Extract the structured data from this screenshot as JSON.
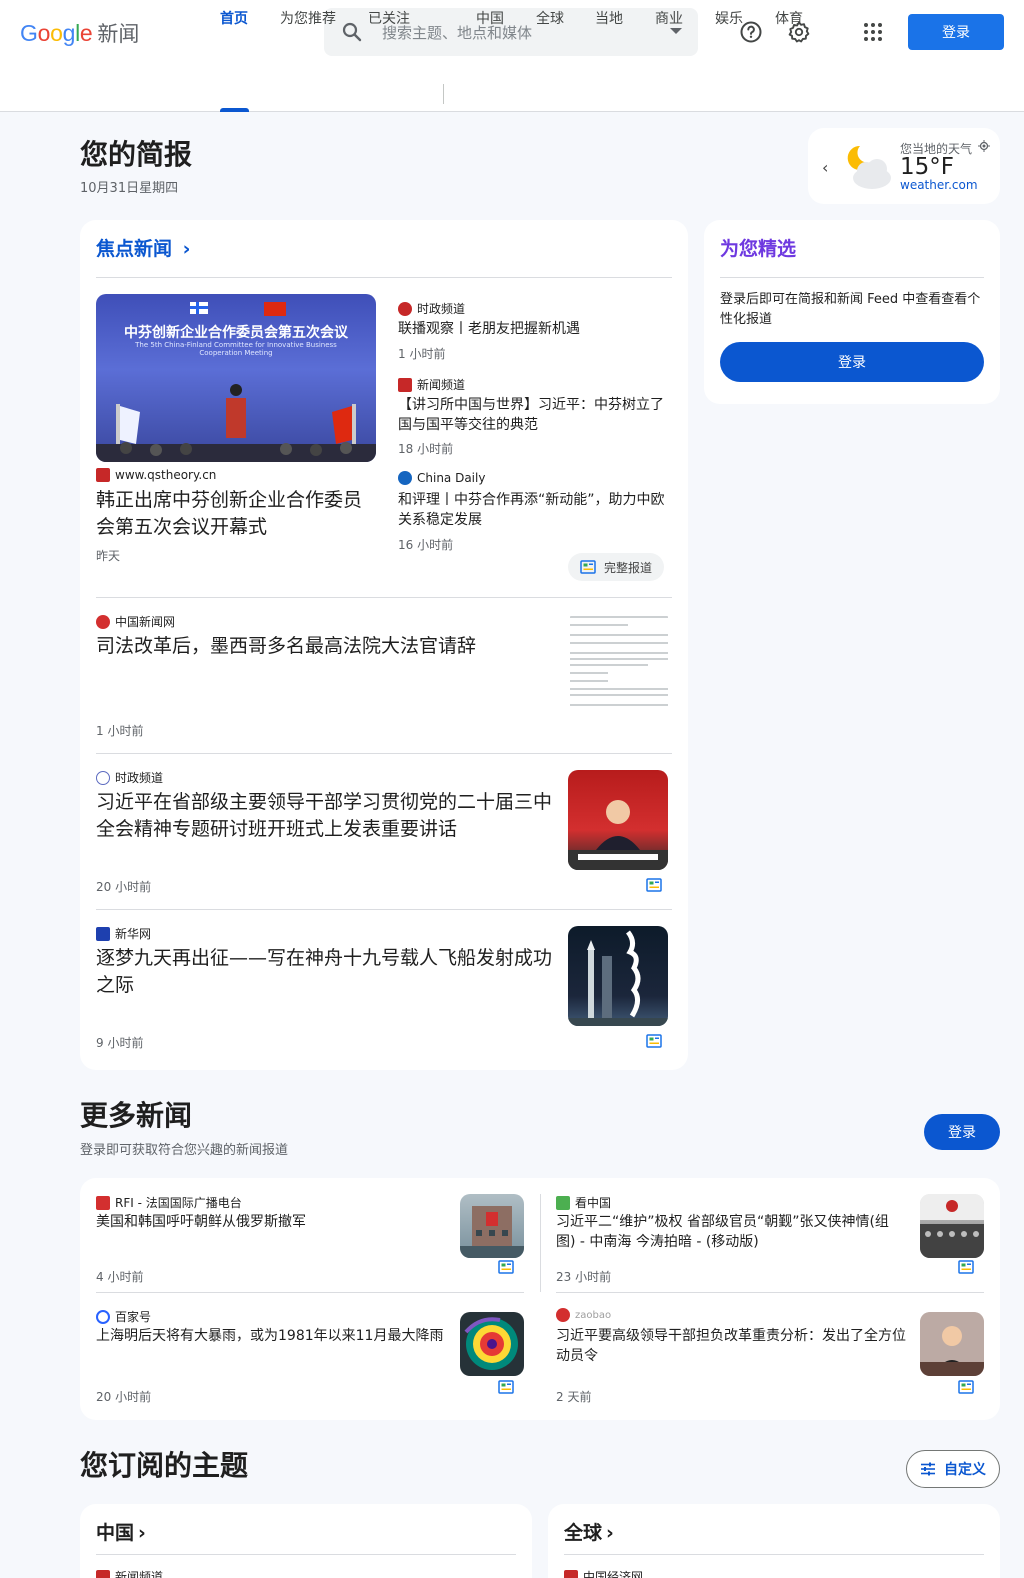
{
  "header": {
    "logo_text": "Google",
    "logo_product": "新闻",
    "search_placeholder": "搜索主题、地点和媒体",
    "signin_label": "登录"
  },
  "tabs": [
    {
      "label": "首页"
    },
    {
      "label": "为您推荐"
    },
    {
      "label": "已关注"
    },
    {
      "label": "中国"
    },
    {
      "label": "全球"
    },
    {
      "label": "当地"
    },
    {
      "label": "商业"
    },
    {
      "label": "娱乐"
    },
    {
      "label": "体育"
    }
  ],
  "briefing": {
    "title": "您的简报",
    "date": "10月31日星期四"
  },
  "weather": {
    "label": "您当地的天气",
    "temp": "15°F",
    "source": "weather.com"
  },
  "top_stories": {
    "title": "焦点新闻",
    "lead": {
      "thumb_title": "中芬创新企业合作委员会第五次会议",
      "thumb_subtitle": "The 5th China-Finland Committee for Innovative Business Cooperation Meeting",
      "source": "www.qstheory.cn",
      "headline": "韩正出席中芬创新企业合作委员会第五次会议开幕式",
      "time": "昨天"
    },
    "related": [
      {
        "source": "时政频道",
        "headline": "联播观察丨老朋友把握新机遇",
        "time": "1 小时前"
      },
      {
        "source": "新闻频道",
        "headline": "【讲习所中国与世界】习近平：中芬树立了国与国平等交往的典范",
        "time": "18 小时前"
      },
      {
        "source": "China Daily",
        "headline": "和评理丨中芬合作再添“新动能”，助力中欧关系稳定发展",
        "time": "16 小时前"
      }
    ],
    "full_coverage": "完整报道",
    "stories": [
      {
        "source": "中国新闻网",
        "headline": "司法改革后，墨西哥多名最高法院大法官请辞",
        "time": "1 小时前"
      },
      {
        "source": "时政频道",
        "headline": "习近平在省部级主要领导干部学习贯彻党的二十届三中全会精神专题研讨班开班式上发表重要讲话",
        "time": "20 小时前"
      },
      {
        "source": "新华网",
        "headline": "逐梦九天再出征——写在神舟十九号载人飞船发射成功之际",
        "time": "9 小时前"
      }
    ]
  },
  "picks": {
    "title": "为您精选",
    "text": "登录后即可在简报和新闻 Feed 中查看查看个性化报道",
    "signin_label": "登录"
  },
  "more_news": {
    "title": "更多新闻",
    "subtitle": "登录即可获取符合您兴趣的新闻报道",
    "signin_label": "登录",
    "items": [
      {
        "source": "RFI - 法国国际广播电台",
        "headline": "美国和韩国呼吁朝鲜从俄罗斯撤军",
        "time": "4 小时前"
      },
      {
        "source": "看中国",
        "headline": "习近平二“维护”极权 省部级官员“朝觐”张又侠神情(组图) - 中南海 今涛拍暗 - (移动版)",
        "time": "23 小时前"
      },
      {
        "source": "百家号",
        "headline": "上海明后天将有大暴雨，或为1981年以来11月最大降雨",
        "time": "20 小时前"
      },
      {
        "source": "zaobao",
        "headline": "习近平要高级领导干部担负改革重责分析：发出了全方位动员令",
        "time": "2 天前"
      }
    ]
  },
  "topics": {
    "title": "您订阅的主题",
    "customize_label": "自定义",
    "cards": [
      {
        "title": "中国",
        "first_source": "新闻频道"
      },
      {
        "title": "全球",
        "first_source": "中国经济网"
      }
    ]
  },
  "colors": {
    "accent": "#0b57d0",
    "button": "#1a73e8",
    "picks_title": "#6e39e0",
    "background": "#f6f8fc"
  }
}
